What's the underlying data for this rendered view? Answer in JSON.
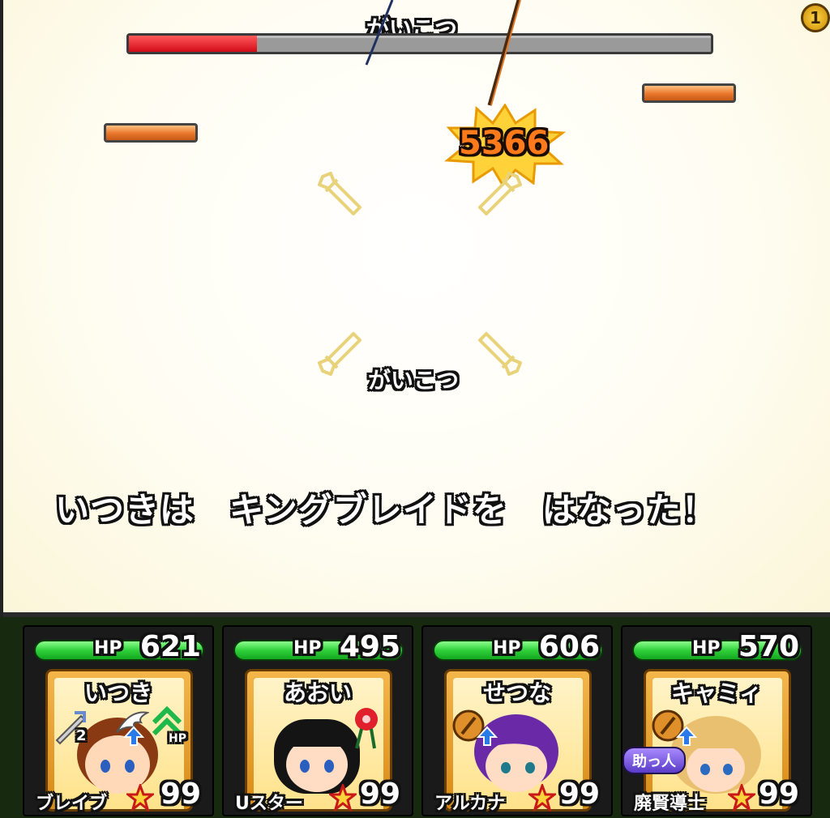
{
  "enemy": {
    "name_top": "がいこつ",
    "name_mid": "がいこつ",
    "hp_fraction": 0.22
  },
  "damage": "5366",
  "turn_counter": "1",
  "message": "いつきは　キングブレイドを　はなった！",
  "party": [
    {
      "hp_label": "HP",
      "hp": "621",
      "name": "いつき",
      "job": "ブレイブ",
      "level": "99",
      "icons": [
        "sword-down-icon",
        "defense-up-icon",
        "wing-icon",
        "hp-regen-icon"
      ],
      "stack": "2",
      "hp_tag": "HP",
      "hair": "#8a3a12",
      "outfit": "#d8e4ff"
    },
    {
      "hp_label": "HP",
      "hp": "495",
      "name": "あおい",
      "job": "Uスター",
      "level": "99",
      "icons": [
        "flower-hairpin-icon"
      ],
      "hair": "#141414",
      "outfit": "#ffe0e0"
    },
    {
      "hp_label": "HP",
      "hp": "606",
      "name": "せつな",
      "job": "アルカナ",
      "level": "99",
      "icons": [
        "staff-icon",
        "up-arrow-icon"
      ],
      "hair": "#6a2aa8",
      "outfit": "#e8d8ff"
    },
    {
      "hp_label": "HP",
      "hp": "570",
      "name": "キャミィ",
      "job": "廃賢導士",
      "level": "99",
      "icons": [
        "staff-icon",
        "up-arrow-icon"
      ],
      "helper": "助っ人",
      "hair": "#e8c070",
      "outfit": "#ffffff"
    }
  ],
  "colors": {
    "enemy_hp": "#d10b18",
    "party_hp": "#2fd03a",
    "damage": "#ff7a1a"
  }
}
